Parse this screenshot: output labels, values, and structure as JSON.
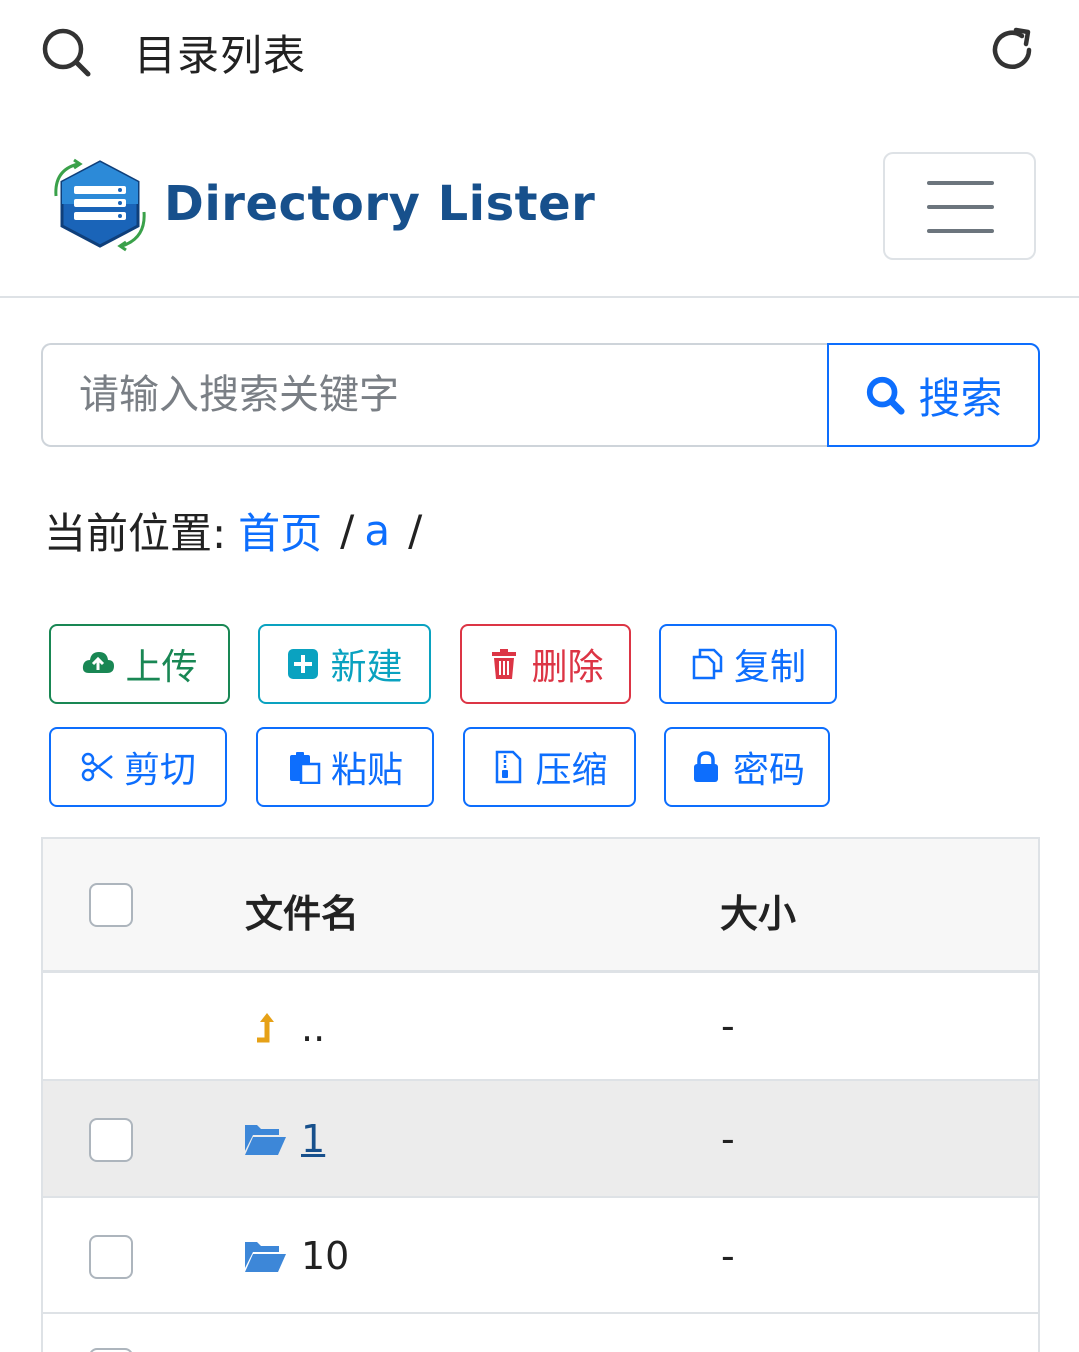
{
  "appbar": {
    "title": "目录列表"
  },
  "brand": {
    "name": "Directory Lister"
  },
  "search": {
    "placeholder": "请输入搜索关键字",
    "button_label": "搜索"
  },
  "breadcrumb": {
    "label": "当前位置:",
    "items": [
      "首页",
      "a"
    ],
    "separator": "/"
  },
  "actions": [
    {
      "label": "上传",
      "icon": "cloud-upload-icon",
      "color": "#198754"
    },
    {
      "label": "新建",
      "icon": "plus-square-icon",
      "color": "#0aa2c0"
    },
    {
      "label": "删除",
      "icon": "trash-icon",
      "color": "#dc3545"
    },
    {
      "label": "复制",
      "icon": "copy-icon",
      "color": "#0d6efd"
    },
    {
      "label": "剪切",
      "icon": "scissors-icon",
      "color": "#0d6efd"
    },
    {
      "label": "粘贴",
      "icon": "paste-icon",
      "color": "#0d6efd"
    },
    {
      "label": "压缩",
      "icon": "zip-file-icon",
      "color": "#0d6efd"
    },
    {
      "label": "密码",
      "icon": "lock-icon",
      "color": "#0d6efd"
    }
  ],
  "table": {
    "headers": {
      "name": "文件名",
      "size": "大小"
    },
    "rows": [
      {
        "name": "..",
        "size": "-",
        "icon": "level-up-icon"
      },
      {
        "name": "1",
        "size": "-",
        "icon": "folder-open-icon",
        "hovered": true
      },
      {
        "name": "10",
        "size": "-",
        "icon": "folder-open-icon"
      }
    ]
  },
  "colors": {
    "primary": "#0d6efd",
    "brand": "#17508c",
    "folder": "#3d87d8",
    "up_arrow": "#e6a117"
  }
}
